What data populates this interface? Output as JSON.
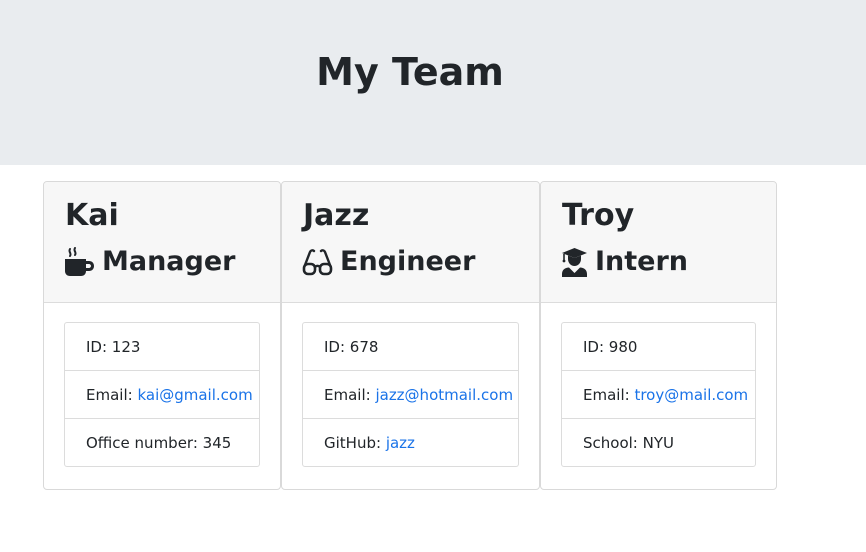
{
  "header": {
    "title": "My Team"
  },
  "colors": {
    "jumbotron_bg": "#e9ecef",
    "link": "#1a73e8",
    "card_header_bg": "#f7f7f7"
  },
  "team": [
    {
      "name": "Kai",
      "role": "Manager",
      "role_icon": "mug-icon",
      "id_label": "ID: ",
      "id": "123",
      "email_label": "Email: ",
      "email": "kai@gmail.com",
      "extra_label": "Office number: ",
      "extra_value": "345"
    },
    {
      "name": "Jazz",
      "role": "Engineer",
      "role_icon": "glasses-icon",
      "id_label": "ID: ",
      "id": "678",
      "email_label": "Email: ",
      "email": "jazz@hotmail.com",
      "extra_label": "GitHub: ",
      "extra_value": "jazz"
    },
    {
      "name": "Troy",
      "role": "Intern",
      "role_icon": "graduate-icon",
      "id_label": "ID: ",
      "id": "980",
      "email_label": "Email: ",
      "email": "troy@mail.com",
      "extra_label": "School: ",
      "extra_value": "NYU"
    }
  ]
}
